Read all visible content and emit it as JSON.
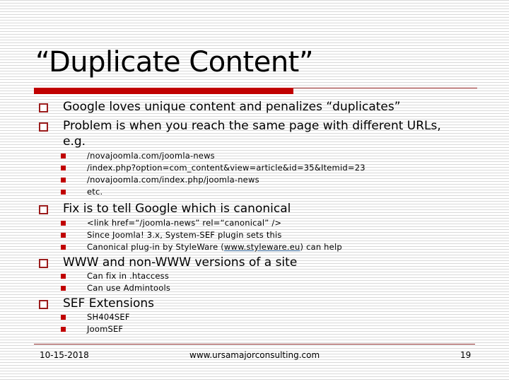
{
  "slide": {
    "title": "“Duplicate Content”",
    "colors": {
      "accent": "#c00000",
      "bullet_outline": "#9b1c1c",
      "link_underline": "#336699"
    },
    "bullets": [
      {
        "text": "Google loves unique content and penalizes “duplicates”",
        "sub": []
      },
      {
        "text": "Problem is when you reach the same page with different URLs,",
        "text_cont": "e.g.",
        "sub": [
          "/novajoomla.com/joomla-news",
          "/index.php?option=com_content&view=article&id=35&Itemid=23",
          "/novajoomla.com/index.php/joomla-news",
          "etc."
        ]
      },
      {
        "text": "Fix is to tell Google which is canonical",
        "sub": [
          "<link href=“/joomla-news” rel=“canonical” />",
          "Since Joomla! 3.x, System-SEF plugin sets this"
        ],
        "sub_link_item": {
          "before": "Canonical plug-in by StyleWare (",
          "link": "www.styleware.eu",
          "after": ") can help"
        }
      },
      {
        "text": "WWW and non-WWW versions of a site",
        "sub": [
          "Can fix in .htaccess",
          "Can use Admintools"
        ]
      },
      {
        "text": "SEF Extensions",
        "sub": [
          "SH404SEF",
          "JoomSEF"
        ]
      }
    ],
    "bullet_icons": {
      "level1": "hollow-square",
      "level2": "filled-square"
    }
  },
  "footer": {
    "date": "10-15-2018",
    "website": "www.ursamajorconsulting.com",
    "page_number": "19"
  }
}
